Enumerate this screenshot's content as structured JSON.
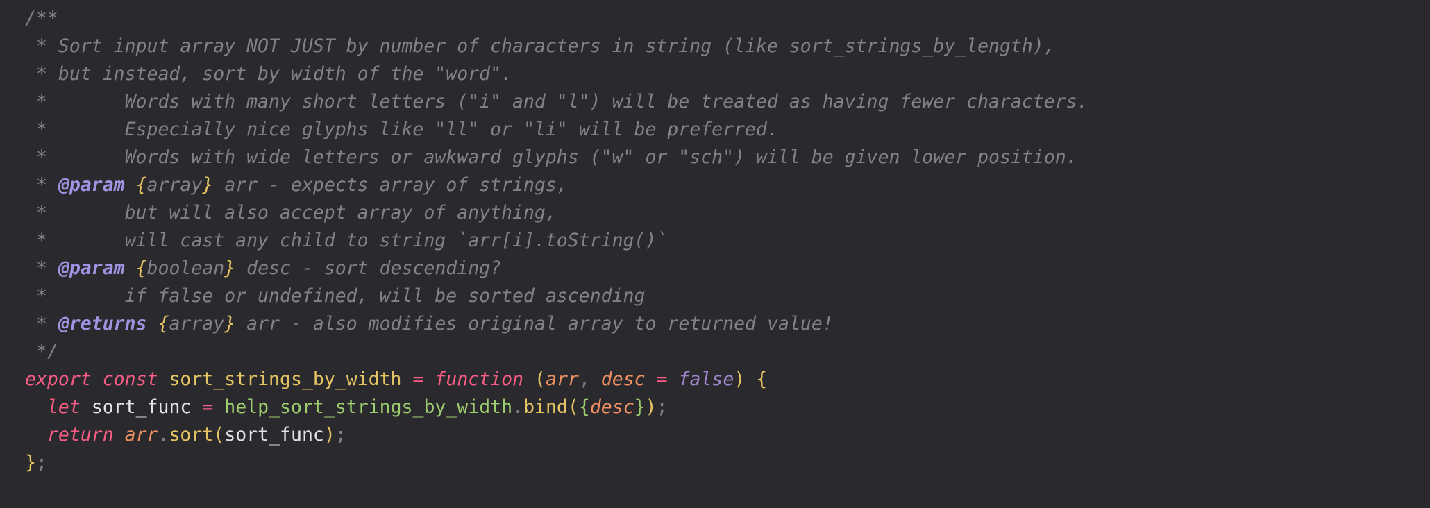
{
  "code": {
    "comment": {
      "open": "/**",
      "l2": " * Sort input array NOT JUST by number of characters in string (like sort_strings_by_length),",
      "l3": " * but instead, sort by width of the \"word\".",
      "l4": " *       Words with many short letters (\"i\" and \"l\") will be treated as having fewer characters.",
      "l5": " *       Especially nice glyphs like \"ll\" or \"li\" will be preferred.",
      "l6": " *       Words with wide letters or awkward glyphs (\"w\" or \"sch\") will be given lower position.",
      "l7_prefix": " * ",
      "l7_tag": "@param",
      "l7_type_open": " {",
      "l7_type": "array",
      "l7_type_close": "}",
      "l7_rest": " arr - expects array of strings,",
      "l8": " *       but will also accept array of anything,",
      "l9": " *       will cast any child to string `arr[i].toString()`",
      "l10_prefix": " * ",
      "l10_tag": "@param",
      "l10_type_open": " {",
      "l10_type": "boolean",
      "l10_type_close": "}",
      "l10_rest": " desc - sort descending?",
      "l11": " *       if false or undefined, will be sorted ascending",
      "l12_prefix": " * ",
      "l12_tag": "@returns",
      "l12_type_open": " {",
      "l12_type": "array",
      "l12_type_close": "}",
      "l12_rest": " arr - also modifies original array to returned value!",
      "close": " */"
    },
    "decl": {
      "export": "export",
      "const": "const",
      "name": "sort_strings_by_width",
      "eq": "=",
      "function": "function",
      "paren_open": "(",
      "arr": "arr",
      "comma": ",",
      "desc": "desc",
      "eq2": "=",
      "false": "false",
      "paren_close": ")",
      "brace_open": "{"
    },
    "line2": {
      "let": "let",
      "var": "sort_func",
      "eq": "=",
      "helper": "help_sort_strings_by_width",
      "dot": ".",
      "bind": "bind",
      "paren_open": "(",
      "obj_open": "{",
      "desc": "desc",
      "obj_close": "}",
      "paren_close": ")",
      "semi": ";"
    },
    "line3": {
      "return": "return",
      "arr": "arr",
      "dot": ".",
      "sort": "sort",
      "paren_open": "(",
      "arg": "sort_func",
      "paren_close": ")",
      "semi": ";"
    },
    "line4": {
      "brace_close": "}",
      "semi": ";"
    }
  }
}
